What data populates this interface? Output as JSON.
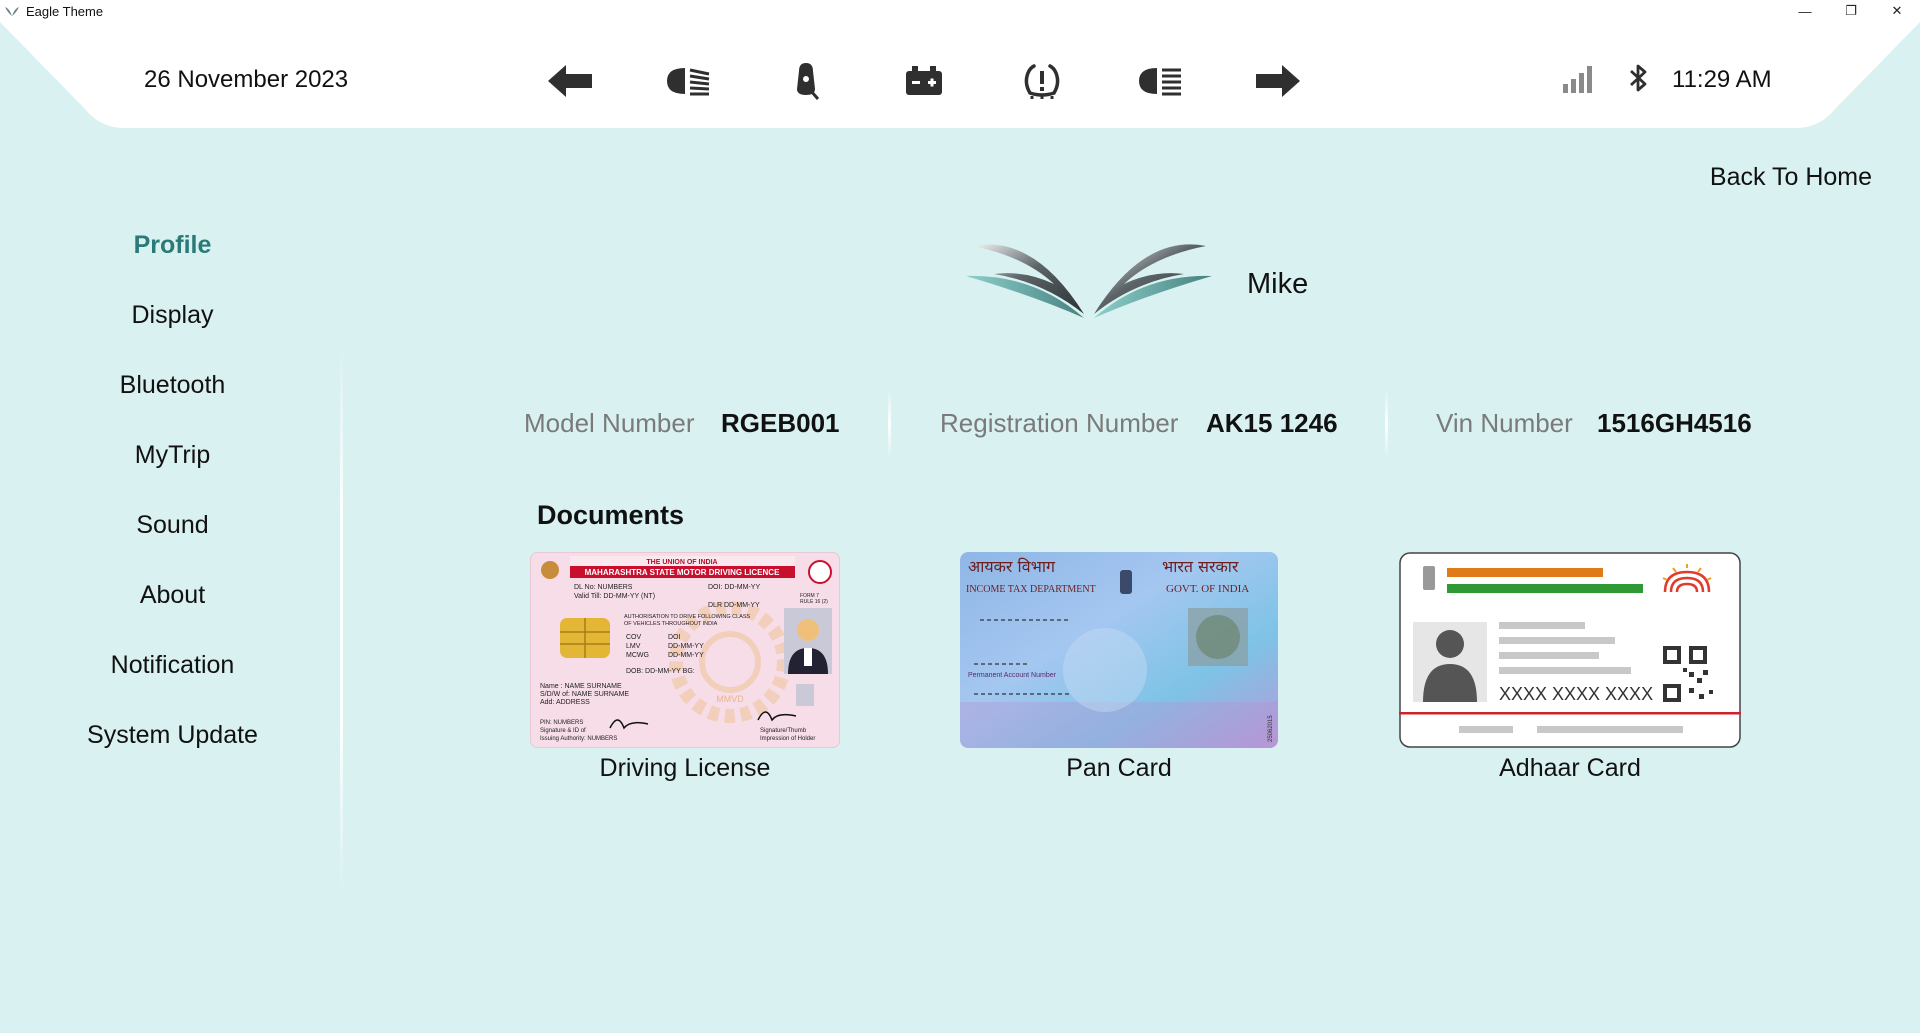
{
  "window": {
    "title": "Eagle Theme",
    "minimize": "—",
    "restore": "❐",
    "close": "✕"
  },
  "status_bar": {
    "date": "26 November 2023",
    "time": "11:29 AM",
    "indicators": [
      "left-turn-icon",
      "low-beam-icon",
      "kickstand-icon",
      "battery-icon",
      "tire-pressure-warning-icon",
      "high-beam-icon",
      "right-turn-icon"
    ],
    "signal_icon": "signal-bars-icon",
    "bluetooth_icon": "bluetooth-icon"
  },
  "back_home": "Back To Home",
  "sidebar": {
    "items": [
      {
        "label": "Profile",
        "active": true
      },
      {
        "label": "Display",
        "active": false
      },
      {
        "label": "Bluetooth",
        "active": false
      },
      {
        "label": "MyTrip",
        "active": false
      },
      {
        "label": "Sound",
        "active": false
      },
      {
        "label": "About",
        "active": false
      },
      {
        "label": "Notification",
        "active": false
      },
      {
        "label": "System Update",
        "active": false
      }
    ]
  },
  "profile": {
    "name": "Mike",
    "model_label": "Model Number",
    "model_value": "RGEB001",
    "registration_label": "Registration Number",
    "registration_value": "AK15 1246",
    "vin_label": "Vin Number",
    "vin_value": "1516GH4516"
  },
  "documents": {
    "title": "Documents",
    "cards": [
      {
        "label": "Driving License"
      },
      {
        "label": "Pan Card"
      },
      {
        "label": "Adhaar Card"
      }
    ],
    "dl": {
      "header1": "THE UNION OF INDIA",
      "header2": "MAHARASHTRA STATE MOTOR DRIVING LICENCE",
      "dl_no": "DL No: NUMBERS",
      "doi": "DOI: DD-MM-YY",
      "valid": "Valid Till: DD-MM-YY (NT)",
      "dlr": "DLR  DD-MM-YY",
      "auth": "AUTHORISATION TO DRIVE FOLLOWING CLASS",
      "auth2": "OF VEHICLES THROUGHOUT INDIA",
      "cov": "COV",
      "doi2": "DOI",
      "lmv": "LMV",
      "lmv_date": "DD-MM-YY",
      "mcwg": "MCWG",
      "mcwg_date": "DD-MM-YY",
      "dob": "DOB:  DD-MM-YY  BG:",
      "name": "Name     : NAME SURNAME",
      "sdw": "S/D/W of: NAME SURNAME",
      "add": "Add: ADDRESS",
      "pin": "PIN: NUMBERS",
      "sig": "Signature & ID of",
      "issuing": "Issuing Authority: NUMBERS",
      "sig2": "Signature/Thumb",
      "impr": "Impression of Holder",
      "form": "FORM 7",
      "rule": "RULE 16 (2)",
      "seal": "MMVD"
    },
    "pan": {
      "hindi_left": "आयकर विभाग",
      "hindi_right": "भारत सरकार",
      "dept": "INCOME TAX DEPARTMENT",
      "govt": "GOVT. OF INDIA",
      "pan_label": "Permanent Account Number",
      "serial": "25062015"
    },
    "aadhaar": {
      "number": "XXXX XXXX XXXX"
    }
  },
  "colors": {
    "background": "#d9f1f1",
    "panel": "#ffffff",
    "active_accent": "#2a7a78",
    "label_gray": "#7a7a7a"
  }
}
